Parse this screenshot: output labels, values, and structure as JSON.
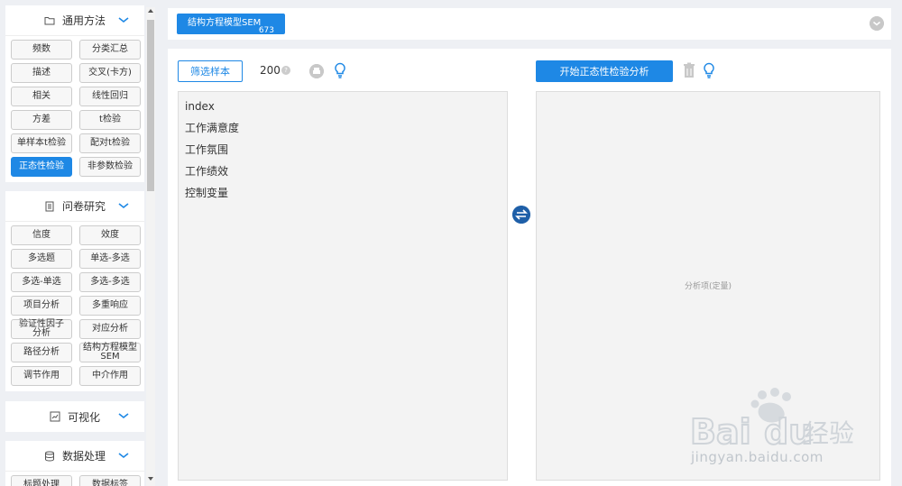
{
  "sidebar": {
    "sections": [
      {
        "title": "通用方法",
        "icon": "folder-icon",
        "items": [
          "频数",
          "分类汇总",
          "描述",
          "交叉(卡方)",
          "相关",
          "线性回归",
          "方差",
          "t检验",
          "单样本t检验",
          "配对t检验",
          "正态性检验",
          "非参数检验"
        ],
        "active": "正态性检验"
      },
      {
        "title": "问卷研究",
        "icon": "document-icon",
        "items": [
          "信度",
          "效度",
          "多选题",
          "单选-多选",
          "多选-单选",
          "多选-多选",
          "项目分析",
          "多重响应",
          "验证性因子\n分析",
          "对应分析",
          "路径分析",
          "结构方程模型\nSEM",
          "调节作用",
          "中介作用"
        ]
      },
      {
        "title": "可视化",
        "icon": "chart-icon",
        "items": []
      },
      {
        "title": "数据处理",
        "icon": "database-icon",
        "items": [
          "标题处理",
          "数据标签"
        ]
      }
    ]
  },
  "top_tab": {
    "label": "结构方程模型SEM",
    "count": "673"
  },
  "toolbar": {
    "filter_label": "筛选样本",
    "sample_count": "200",
    "help_mark": "?",
    "start_label": "开始正态性检验分析"
  },
  "variables": [
    "index",
    "工作满意度",
    "工作氛围",
    "工作绩效",
    "控制变量"
  ],
  "analysis": {
    "placeholder": "分析项(定量)"
  },
  "watermark": {
    "url": "jingyan.baidu.com"
  },
  "colors": {
    "accent": "#1e88e5",
    "swap": "#1e5fa8"
  }
}
